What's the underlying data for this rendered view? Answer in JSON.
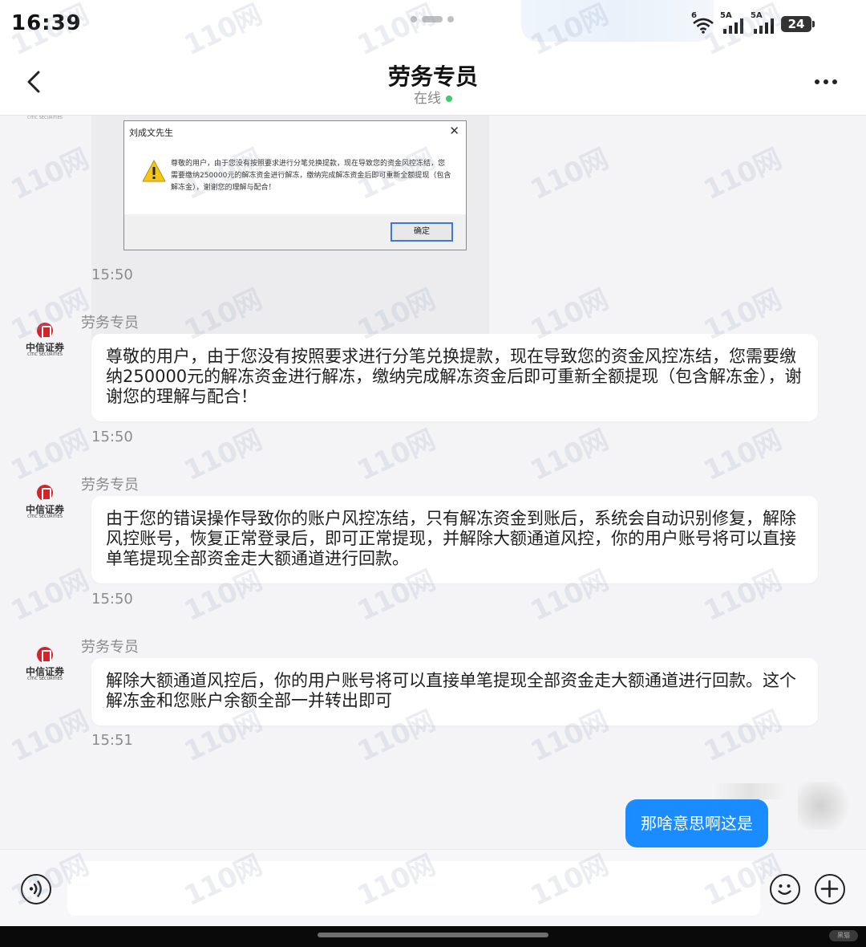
{
  "status_bar": {
    "time": "16:39",
    "signal1_label": "5A",
    "signal2_label": "5A",
    "wifi_label": "6",
    "battery": "24"
  },
  "header": {
    "title": "劳务专员",
    "status": "在线"
  },
  "image_message": {
    "dialog_title": "刘成文先生",
    "dialog_text": "尊敬的用户，由于您没有按照要求进行分笔兑换提款，现在导致您的资金风控冻结，您需要缴纳250000元的解冻资金进行解冻，缴纳完成解冻资金后即可重新全额提现（包含解冻金），谢谢您的理解与配合！",
    "ok_label": "确定",
    "close_label": "✕",
    "time": "15:50"
  },
  "messages": [
    {
      "sender": "劳务专员",
      "avatar_cn": "中信证券",
      "avatar_en": "CITIC SECURITIES",
      "text": "尊敬的用户，由于您没有按照要求进行分笔兑换提款，现在导致您的资金风控冻结，您需要缴纳250000元的解冻资金进行解冻，缴纳完成解冻资金后即可重新全额提现（包含解冻金），谢谢您的理解与配合！",
      "time": "15:50"
    },
    {
      "sender": "劳务专员",
      "avatar_cn": "中信证券",
      "avatar_en": "CITIC SECURITIES",
      "text": "由于您的错误操作导致你的账户风控冻结，只有解冻资金到账后，系统会自动识别修复，解除风控账号，恢复正常登录后，即可正常提现，并解除大额通道风控，你的用户账号将可以直接单笔提现全部资金走大额通道进行回款。",
      "time": "15:50"
    },
    {
      "sender": "劳务专员",
      "avatar_cn": "中信证券",
      "avatar_en": "CITIC SECURITIES",
      "text": "解除大额通道风控后，你的用户账号将可以直接单笔提现全部资金走大额通道进行回款。这个解冻金和您账户余额全部一并转出即可",
      "time": "15:51"
    }
  ],
  "outgoing_message": {
    "text": "那啥意思啊这是"
  },
  "input_bar": {
    "value": ""
  },
  "watermark": "110网",
  "corner_tag": "黑猫"
}
